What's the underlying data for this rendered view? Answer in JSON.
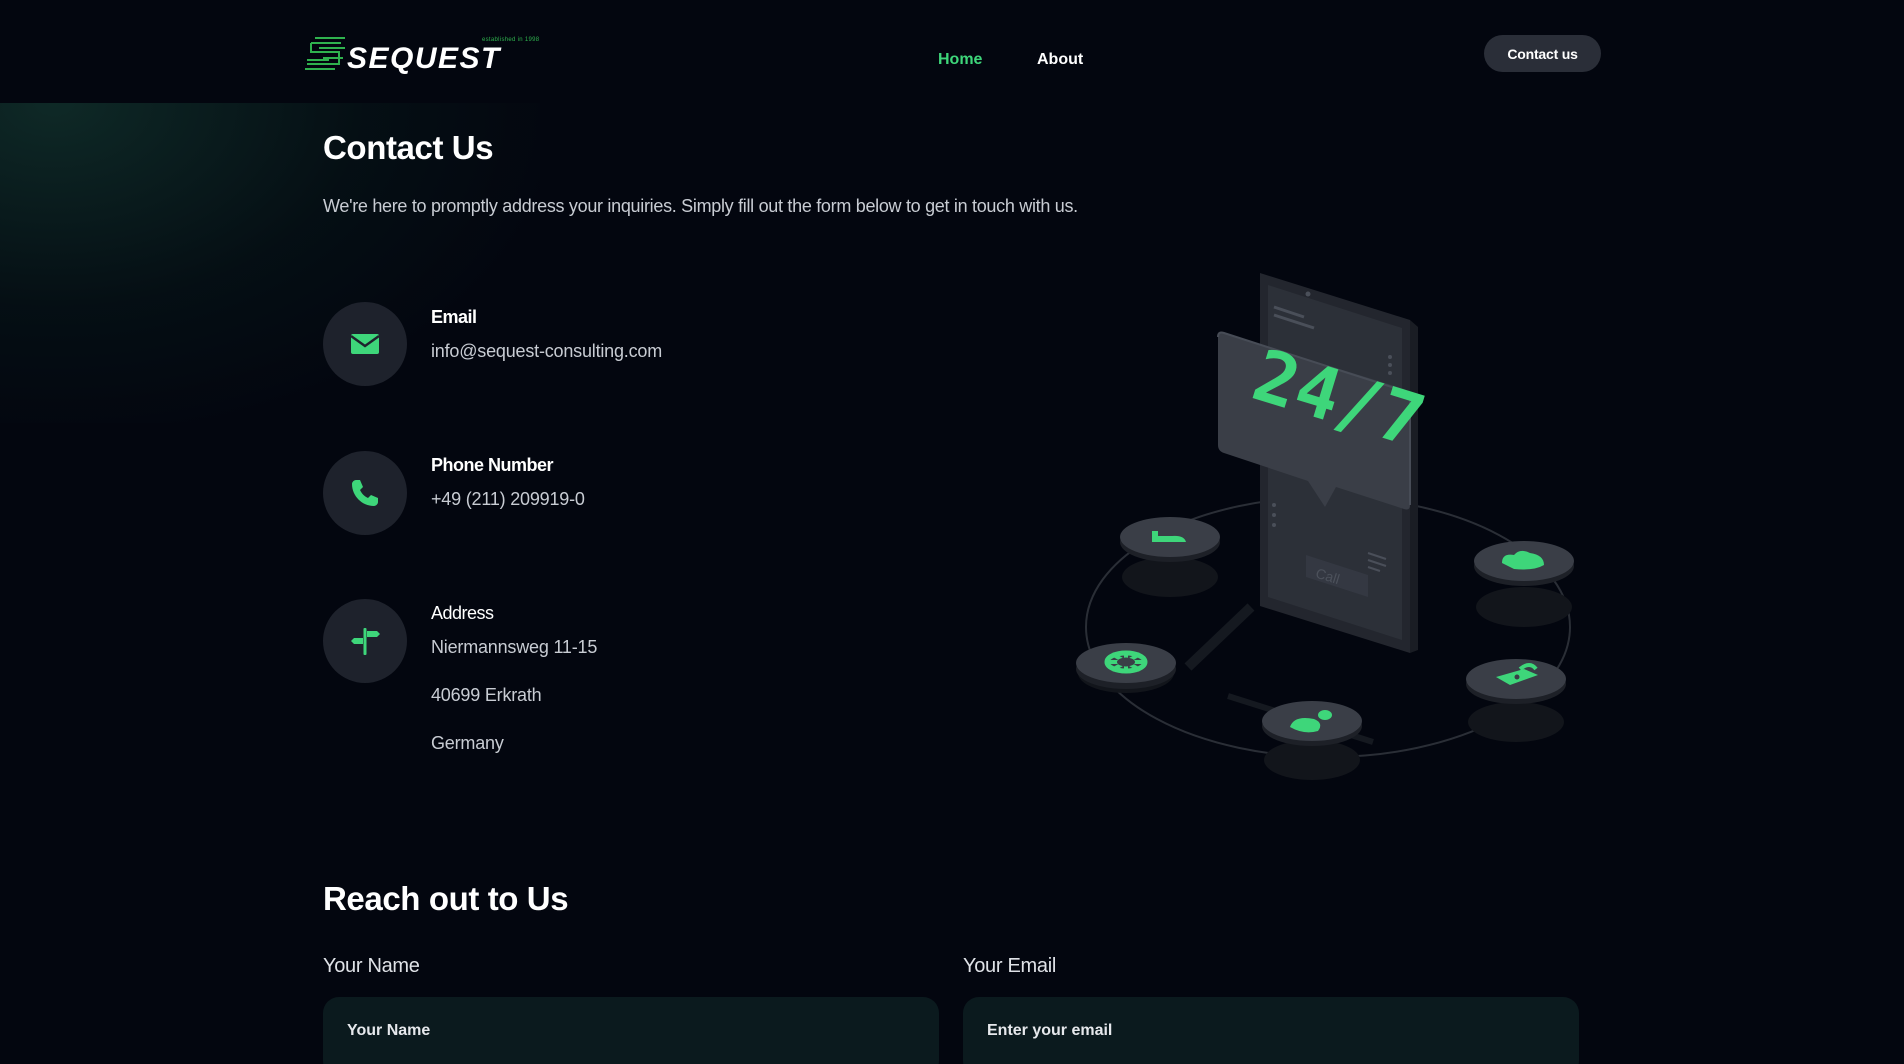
{
  "header": {
    "logo_text": "SEQUEST",
    "logo_tagline": "established in 1998",
    "nav": [
      {
        "label": "Home"
      },
      {
        "label": "About"
      }
    ],
    "contact_button": "Contact us"
  },
  "intro": {
    "title": "Contact Us",
    "subtitle": "We're here to promptly address your inquiries. Simply fill out the form below to get in touch with us."
  },
  "contacts": {
    "email": {
      "label": "Email",
      "value": "info@sequest-consulting.com",
      "icon": "envelope-icon"
    },
    "phone": {
      "label": "Phone Number",
      "value": "+49 (211) 209919-0",
      "icon": "phone-icon"
    },
    "address": {
      "label": "Address",
      "lines": [
        "Niermannsweg 11-15",
        "40699 Erkrath",
        "Germany"
      ],
      "icon": "signpost-icon"
    }
  },
  "illustration": {
    "badge_text": "24/7",
    "call_text": "Call"
  },
  "form": {
    "title": "Reach out to Us",
    "name_label": "Your Name",
    "name_placeholder": "Your Name",
    "email_label": "Your Email",
    "email_placeholder": "Enter your email"
  },
  "colors": {
    "background": "#03060f",
    "accent": "#3ed67a",
    "surface": "#1e222c",
    "input_bg": "#0b1a1e"
  }
}
